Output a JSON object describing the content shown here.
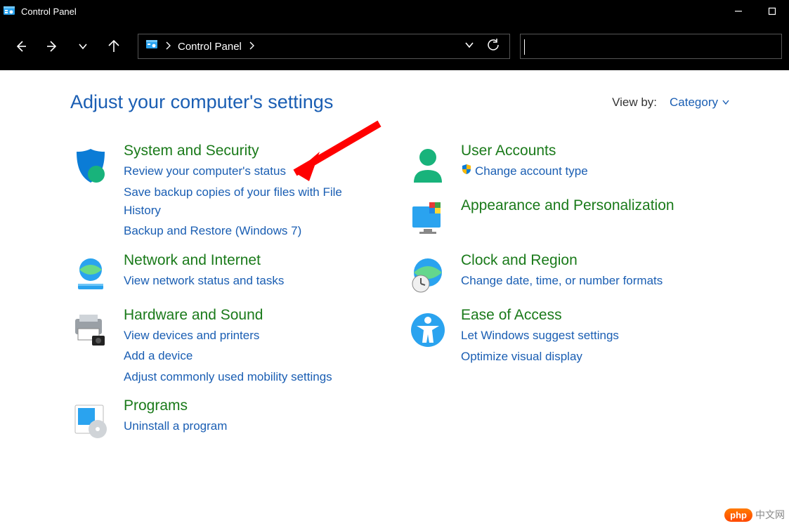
{
  "window": {
    "title": "Control Panel"
  },
  "breadcrumb": {
    "root": "Control Panel"
  },
  "header": {
    "page_title": "Adjust your computer's settings",
    "view_by_label": "View by:",
    "view_by_value": "Category"
  },
  "categories_left": [
    {
      "title": "System and Security",
      "links": [
        "Review your computer's status",
        "Save backup copies of your files with File History",
        "Backup and Restore (Windows 7)"
      ]
    },
    {
      "title": "Network and Internet",
      "links": [
        "View network status and tasks"
      ]
    },
    {
      "title": "Hardware and Sound",
      "links": [
        "View devices and printers",
        "Add a device",
        "Adjust commonly used mobility settings"
      ]
    },
    {
      "title": "Programs",
      "links": [
        "Uninstall a program"
      ]
    }
  ],
  "categories_right": [
    {
      "title": "User Accounts",
      "links": [
        "Change account type"
      ],
      "link_shield": [
        true
      ]
    },
    {
      "title": "Appearance and Personalization",
      "links": []
    },
    {
      "title": "Clock and Region",
      "links": [
        "Change date, time, or number formats"
      ]
    },
    {
      "title": "Ease of Access",
      "links": [
        "Let Windows suggest settings",
        "Optimize visual display"
      ]
    }
  ],
  "watermark": {
    "brand": "php",
    "text": "中文网"
  }
}
